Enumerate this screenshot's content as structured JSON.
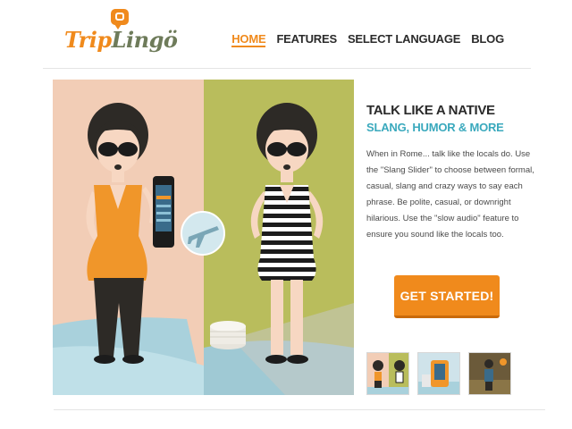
{
  "brand": {
    "name_part1": "Trip",
    "name_part2": "Lingö"
  },
  "nav": [
    {
      "label": "HOME",
      "active": true
    },
    {
      "label": "FEATURES",
      "active": false
    },
    {
      "label": "SELECT LANGUAGE",
      "active": false
    },
    {
      "label": "BLOG",
      "active": false
    }
  ],
  "hero": {
    "headline": "TALK LIKE A NATIVE",
    "subhead": "SLANG, HUMOR & MORE",
    "description": "When in Rome... talk like the locals do. Use the \"Slang Slider\" to choose between formal, casual, slang and crazy ways to say each phrase. Be polite, casual, or downright hilarious. Use the \"slow audio\" feature to ensure you sound like the locals too.",
    "cta_label": "GET STARTED!"
  },
  "thumbnails": [
    {
      "icon": "two-women-thumbnail"
    },
    {
      "icon": "phone-thumbnail"
    },
    {
      "icon": "figure-thumbnail"
    }
  ],
  "colors": {
    "accent": "#f08a1c",
    "teal": "#3aa9bd",
    "olive": "#b8bc5a",
    "peach": "#f2cdb6"
  }
}
